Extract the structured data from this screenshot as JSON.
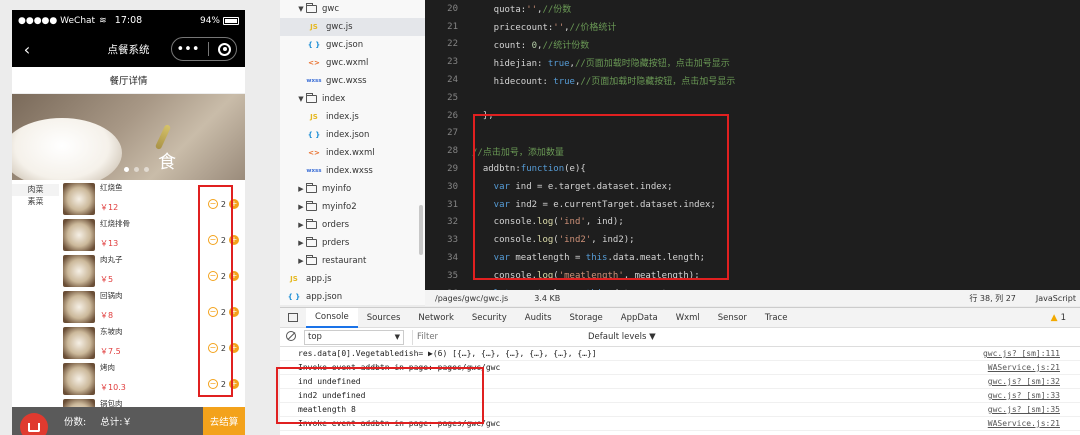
{
  "phone": {
    "status": {
      "carrier": "●●●●● WeChat",
      "time": "17:08",
      "battery": "94%"
    },
    "nav": {
      "title": "点餐系统",
      "more": "•••"
    },
    "subheader": "餐厅详情",
    "banner_glyph": "食",
    "categories": [
      {
        "label": "肉菜"
      },
      {
        "label": "素菜"
      }
    ],
    "dishes": [
      {
        "name": "红烧鱼",
        "price": "￥12",
        "count": "2",
        "minus": "−",
        "plus": "+"
      },
      {
        "name": "红烧排骨",
        "price": "￥13",
        "count": "2",
        "minus": "−",
        "plus": "+"
      },
      {
        "name": "肉丸子",
        "price": "￥5",
        "count": "2",
        "minus": "−",
        "plus": "+"
      },
      {
        "name": "回锅肉",
        "price": "￥8",
        "count": "2",
        "minus": "−",
        "plus": "+"
      },
      {
        "name": "东坡肉",
        "price": "￥7.5",
        "count": "2",
        "minus": "−",
        "plus": "+"
      },
      {
        "name": "烤肉",
        "price": "￥10.3",
        "count": "2",
        "minus": "−",
        "plus": "+"
      },
      {
        "name": "锅包肉",
        "price": "",
        "count": "",
        "minus": "",
        "plus": ""
      }
    ],
    "cart": {
      "count_label": "份数:",
      "total_label": "总计:￥",
      "checkout": "去结算"
    }
  },
  "filetree": [
    {
      "type": "folder",
      "open": true,
      "indent": 1,
      "name": "gwc"
    },
    {
      "type": "js",
      "indent": 2,
      "icon": "JS",
      "name": "gwc.js",
      "selected": true
    },
    {
      "type": "json",
      "indent": 2,
      "icon": "{ }",
      "name": "gwc.json"
    },
    {
      "type": "wxml",
      "indent": 2,
      "icon": "<>",
      "name": "gwc.wxml"
    },
    {
      "type": "wxss",
      "indent": 2,
      "icon": "wxss",
      "name": "gwc.wxss"
    },
    {
      "type": "folder",
      "open": true,
      "indent": 1,
      "name": "index"
    },
    {
      "type": "js",
      "indent": 2,
      "icon": "JS",
      "name": "index.js"
    },
    {
      "type": "json",
      "indent": 2,
      "icon": "{ }",
      "name": "index.json"
    },
    {
      "type": "wxml",
      "indent": 2,
      "icon": "<>",
      "name": "index.wxml"
    },
    {
      "type": "wxss",
      "indent": 2,
      "icon": "wxss",
      "name": "index.wxss"
    },
    {
      "type": "folder",
      "open": false,
      "indent": 1,
      "name": "myinfo"
    },
    {
      "type": "folder",
      "open": false,
      "indent": 1,
      "name": "myinfo2"
    },
    {
      "type": "folder",
      "open": false,
      "indent": 1,
      "name": "orders"
    },
    {
      "type": "folder",
      "open": false,
      "indent": 1,
      "name": "prders"
    },
    {
      "type": "folder",
      "open": false,
      "indent": 1,
      "name": "restaurant"
    },
    {
      "type": "js",
      "indent": 0,
      "icon": "JS",
      "name": "app.js"
    },
    {
      "type": "json",
      "indent": 0,
      "icon": "{ }",
      "name": "app.json"
    },
    {
      "type": "wxss",
      "indent": 0,
      "icon": "wxss",
      "name": "app.wxss"
    }
  ],
  "editor": {
    "lines": [
      {
        "n": "20",
        "tokens": [
          [
            "c-plain",
            "    quota:"
          ],
          [
            "c-str",
            "''"
          ],
          [
            "c-plain",
            ","
          ],
          [
            "c-com",
            "//份数"
          ]
        ]
      },
      {
        "n": "21",
        "tokens": [
          [
            "c-plain",
            "    pricecount:"
          ],
          [
            "c-str",
            "''"
          ],
          [
            "c-plain",
            ","
          ],
          [
            "c-com",
            "//价格统计"
          ]
        ]
      },
      {
        "n": "22",
        "tokens": [
          [
            "c-plain",
            "    count: "
          ],
          [
            "c-num",
            "0"
          ],
          [
            "c-plain",
            ","
          ],
          [
            "c-com",
            "//统计份数"
          ]
        ]
      },
      {
        "n": "23",
        "tokens": [
          [
            "c-plain",
            "    hidejian: "
          ],
          [
            "c-kw",
            "true"
          ],
          [
            "c-plain",
            ","
          ],
          [
            "c-com",
            "//页面加载时隐藏按钮，点击加号显示"
          ]
        ]
      },
      {
        "n": "24",
        "tokens": [
          [
            "c-plain",
            "    hidecount: "
          ],
          [
            "c-kw",
            "true"
          ],
          [
            "c-plain",
            ","
          ],
          [
            "c-com",
            "//页面加载时隐藏按钮，点击加号显示"
          ]
        ]
      },
      {
        "n": "25",
        "tokens": [
          [
            "c-plain",
            ""
          ]
        ]
      },
      {
        "n": "26",
        "tokens": [
          [
            "c-plain",
            "  },"
          ]
        ]
      },
      {
        "n": "27",
        "tokens": [
          [
            "c-plain",
            ""
          ]
        ]
      },
      {
        "n": "28",
        "tokens": [
          [
            "c-com",
            "//点击加号，添加数量"
          ]
        ]
      },
      {
        "n": "29",
        "tokens": [
          [
            "c-plain",
            "  addbtn:"
          ],
          [
            "c-kw",
            "function"
          ],
          [
            "c-plain",
            "(e){"
          ]
        ]
      },
      {
        "n": "30",
        "tokens": [
          [
            "c-kw",
            "    var"
          ],
          [
            "c-plain",
            " ind = e.target.dataset.index;"
          ]
        ]
      },
      {
        "n": "31",
        "tokens": [
          [
            "c-kw",
            "    var"
          ],
          [
            "c-plain",
            " ind2 = e.currentTarget.dataset.index;"
          ]
        ]
      },
      {
        "n": "32",
        "tokens": [
          [
            "c-plain",
            "    console."
          ],
          [
            "c-fn",
            "log"
          ],
          [
            "c-plain",
            "("
          ],
          [
            "c-str",
            "'ind'"
          ],
          [
            "c-plain",
            ", ind);"
          ]
        ]
      },
      {
        "n": "33",
        "tokens": [
          [
            "c-plain",
            "    console."
          ],
          [
            "c-fn",
            "log"
          ],
          [
            "c-plain",
            "("
          ],
          [
            "c-str",
            "'ind2'"
          ],
          [
            "c-plain",
            ", ind2);"
          ]
        ]
      },
      {
        "n": "34",
        "tokens": [
          [
            "c-kw",
            "    var"
          ],
          [
            "c-plain",
            " meatlength = "
          ],
          [
            "c-kw",
            "this"
          ],
          [
            "c-plain",
            ".data.meat.length;"
          ]
        ]
      },
      {
        "n": "35",
        "tokens": [
          [
            "c-plain",
            "    console."
          ],
          [
            "c-fn",
            "log"
          ],
          [
            "c-plain",
            "("
          ],
          [
            "c-str",
            "'meatlength'"
          ],
          [
            "c-plain",
            ", meatlength);"
          ]
        ]
      },
      {
        "n": "36",
        "tokens": [
          [
            "c-kw",
            "    let"
          ],
          [
            "c-plain",
            " countvalue = "
          ],
          [
            "c-kw",
            "this"
          ],
          [
            "c-plain",
            ".data.count;"
          ]
        ]
      },
      {
        "n": "37",
        "tokens": [
          [
            "c-kw",
            "    this"
          ],
          [
            "c-plain",
            "."
          ],
          [
            "c-fn",
            "setData"
          ],
          [
            "c-plain",
            "({"
          ]
        ]
      },
      {
        "n": "38",
        "tokens": [
          [
            "c-plain",
            "      count: (countvalue+"
          ],
          [
            "c-num",
            "1"
          ],
          [
            "c-plain",
            ")"
          ]
        ]
      },
      {
        "n": "39",
        "tokens": [
          [
            "c-plain",
            "    })"
          ]
        ]
      }
    ]
  },
  "editor_status": {
    "path": "/pages/gwc/gwc.js",
    "size": "3.4 KB",
    "position": "行 38, 列 27",
    "language": "JavaScript"
  },
  "devtools": {
    "tabs": [
      "Console",
      "Sources",
      "Network",
      "Security",
      "Audits",
      "Storage",
      "AppData",
      "Wxml",
      "Sensor",
      "Trace"
    ],
    "active_tab": "Console",
    "warning_count": "1",
    "context": "top",
    "filter_placeholder": "Filter",
    "levels": "Default levels ▼",
    "logs": [
      {
        "msg": "res.data[0].Vegetabledish= ▶(6) [{…}, {…}, {…}, {…}, {…}, {…}]",
        "source": "gwc.js? [sm]:111"
      },
      {
        "msg": "Invoke event addbtn in page: pages/gwc/gwc",
        "source": "WAService.js:21"
      },
      {
        "msg": "ind undefined",
        "source": "gwc.js? [sm]:32"
      },
      {
        "msg": "ind2 undefined",
        "source": "gwc.js? [sm]:33"
      },
      {
        "msg": "meatlength 8",
        "source": "gwc.js? [sm]:35"
      },
      {
        "msg": "Invoke event addbtn in page: pages/gwc/gwc",
        "source": "WAService.js:21"
      }
    ]
  },
  "colors": {
    "accent_orange": "#f3a21b",
    "price_red": "#e03c3c",
    "highlight_red": "#e02020",
    "editor_bg": "#1e1e1e"
  }
}
